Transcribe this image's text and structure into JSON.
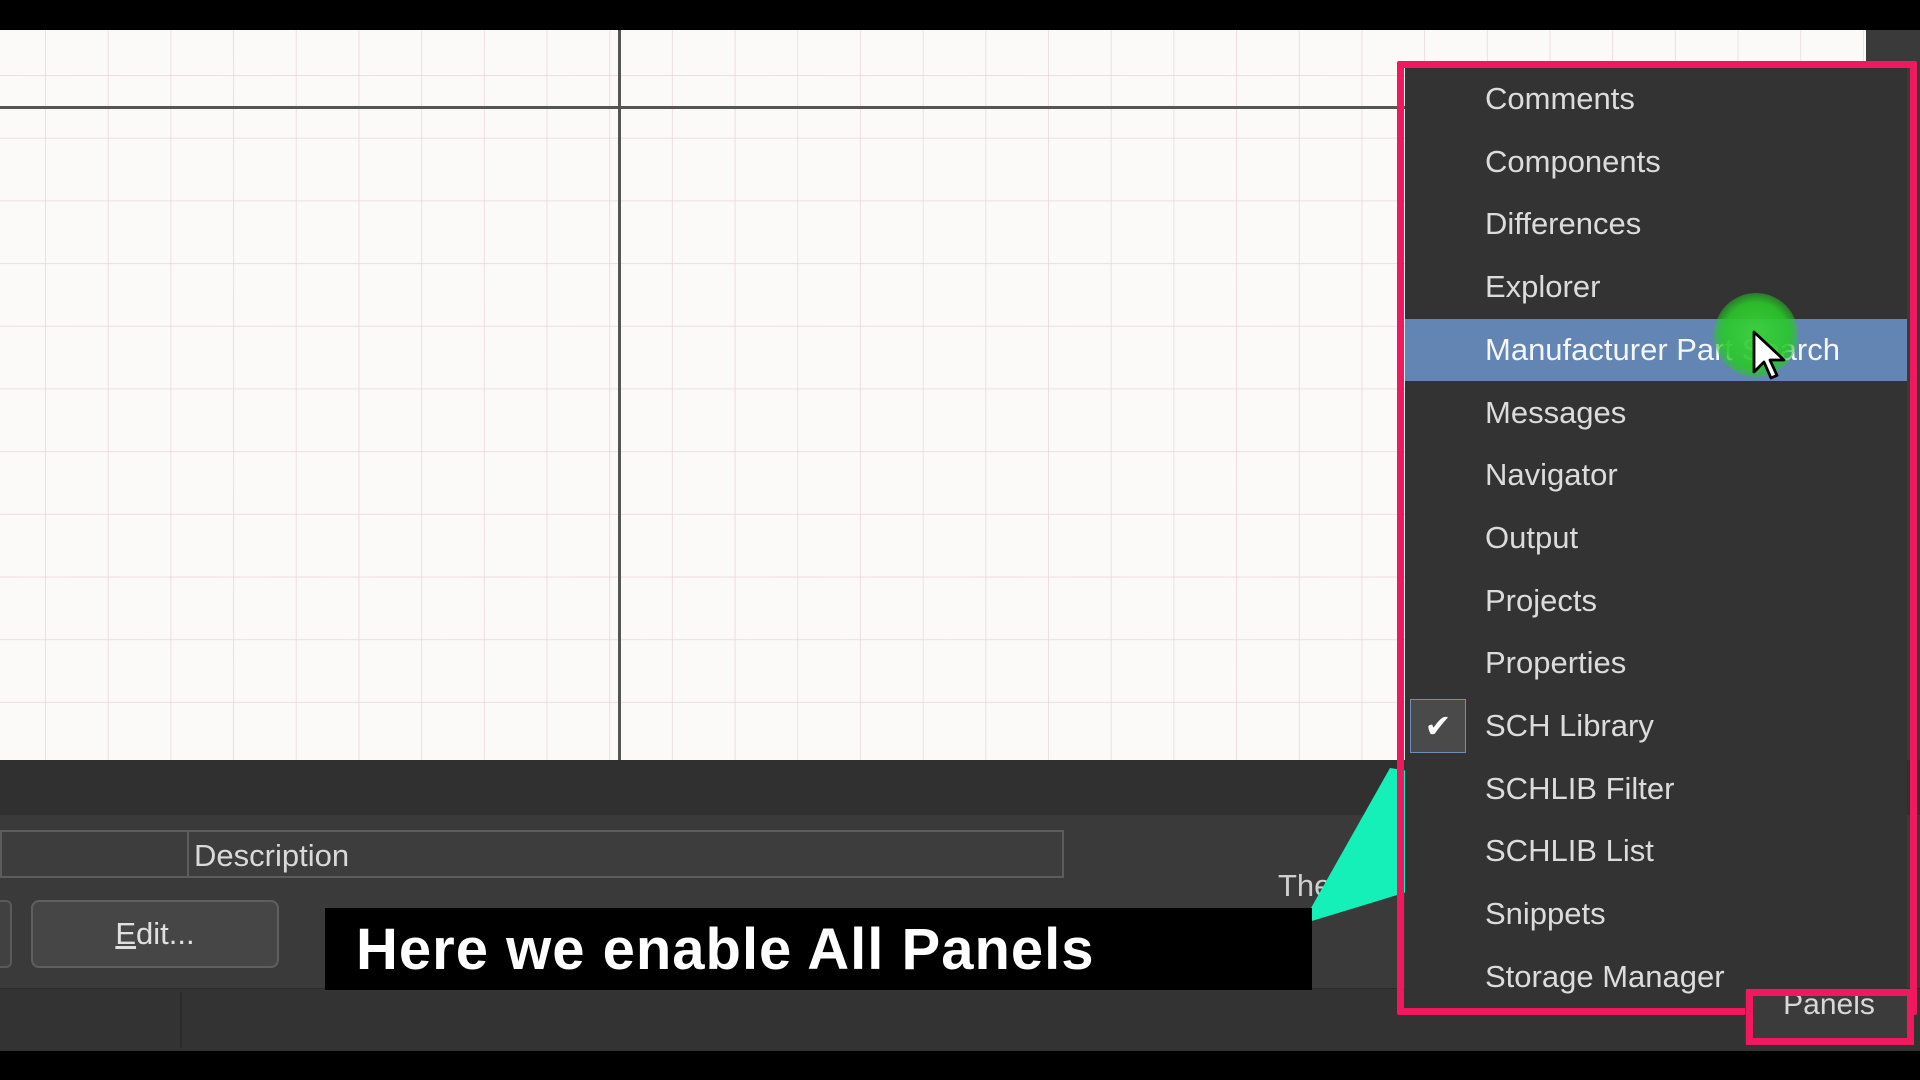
{
  "bottom_panel": {
    "description_header": "Description",
    "edit_button": {
      "underlined": "E",
      "rest": "dit..."
    },
    "partial_hidden_text": "The"
  },
  "caption": "Here we enable All Panels",
  "panels_menu": {
    "items": [
      {
        "label": "Comments",
        "checked": false,
        "hovered": false
      },
      {
        "label": "Components",
        "checked": false,
        "hovered": false
      },
      {
        "label": "Differences",
        "checked": false,
        "hovered": false
      },
      {
        "label": "Explorer",
        "checked": false,
        "hovered": false
      },
      {
        "label": "Manufacturer Part Search",
        "checked": false,
        "hovered": true
      },
      {
        "label": "Messages",
        "checked": false,
        "hovered": false
      },
      {
        "label": "Navigator",
        "checked": false,
        "hovered": false
      },
      {
        "label": "Output",
        "checked": false,
        "hovered": false
      },
      {
        "label": "Projects",
        "checked": false,
        "hovered": false
      },
      {
        "label": "Properties",
        "checked": false,
        "hovered": false
      },
      {
        "label": "SCH Library",
        "checked": true,
        "hovered": false
      },
      {
        "label": "SCHLIB Filter",
        "checked": false,
        "hovered": false
      },
      {
        "label": "SCHLIB List",
        "checked": false,
        "hovered": false
      },
      {
        "label": "Snippets",
        "checked": false,
        "hovered": false
      },
      {
        "label": "Storage Manager",
        "checked": false,
        "hovered": false
      }
    ]
  },
  "status_bar": {
    "panels_button": "Panels"
  },
  "colors": {
    "highlight": "#f0185e",
    "callout_arrow": "#14f0b8",
    "menu_hover": "#6285b3",
    "click_indicator": "#3cd23c"
  },
  "icons": {
    "check": "check-icon",
    "cursor": "mouse-cursor-icon"
  }
}
